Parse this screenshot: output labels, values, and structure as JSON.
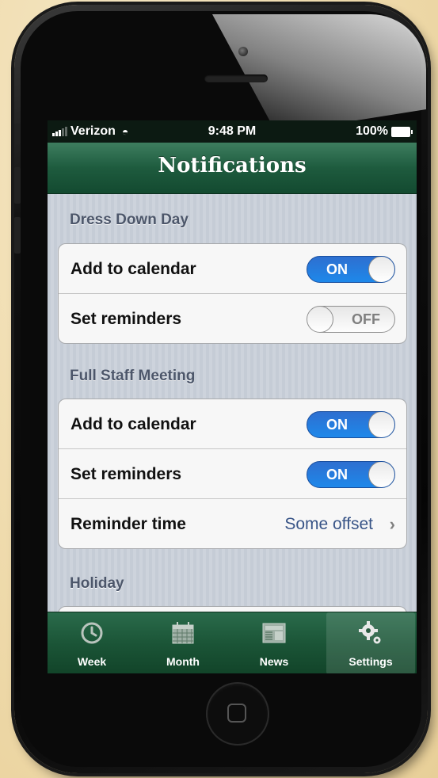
{
  "status_bar": {
    "carrier": "Verizon",
    "time": "9:48 PM",
    "battery": "100%"
  },
  "nav": {
    "title": "Notifications"
  },
  "sections": [
    {
      "header": "Dress Down Day",
      "rows": [
        {
          "label": "Add to calendar",
          "toggle": "ON"
        },
        {
          "label": "Set reminders",
          "toggle": "OFF"
        }
      ]
    },
    {
      "header": "Full Staff Meeting",
      "rows": [
        {
          "label": "Add to calendar",
          "toggle": "ON"
        },
        {
          "label": "Set reminders",
          "toggle": "ON"
        },
        {
          "label": "Reminder time",
          "value": "Some offset"
        }
      ]
    },
    {
      "header": "Holiday",
      "rows": []
    }
  ],
  "tabs": [
    {
      "label": "Week",
      "icon": "clock-icon",
      "selected": false
    },
    {
      "label": "Month",
      "icon": "calendar-icon",
      "selected": false
    },
    {
      "label": "News",
      "icon": "newspaper-icon",
      "selected": false
    },
    {
      "label": "Settings",
      "icon": "gears-icon",
      "selected": true
    }
  ],
  "colors": {
    "nav_green": "#1e5b3e",
    "toggle_on_blue": "#1e88ea",
    "value_blue": "#385487"
  }
}
